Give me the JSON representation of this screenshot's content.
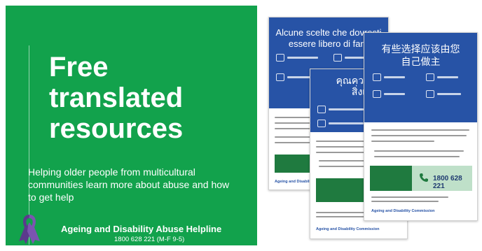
{
  "promo": {
    "headline": [
      "Free",
      "translated",
      "resources"
    ],
    "subtext": "Helping older people from multicultural communities learn more about abuse and how to get help",
    "helpline_name": "Ageing and Disability Abuse Helpline",
    "helpline_number": "1800 628 221 (M-F 9-5)",
    "ribbon_icon": "purple-ribbon-icon"
  },
  "documents": [
    {
      "title_line1": "Alcune scelte che dovresti",
      "title_line2": "essere libero di fare",
      "commission": "Ageing and Disability"
    },
    {
      "title_line1": "คุณควรมีสิ",
      "title_line2": "สิ่งเ",
      "commission": "Ageing and Disability Commission"
    },
    {
      "title_line1": "有些选择应该由您",
      "title_line2": "自己做主",
      "phone": "1800 628 221",
      "commission": "Ageing and Disability Commission"
    }
  ],
  "colors": {
    "green": "#12a24c",
    "doc_blue": "#2753a6",
    "ribbon_purple": "#5b3a8c"
  }
}
